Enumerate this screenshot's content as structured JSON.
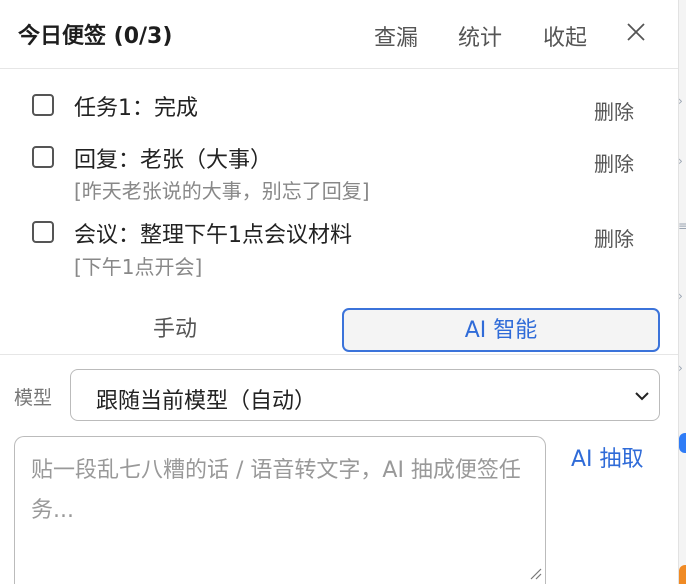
{
  "header": {
    "title": "今日便签 (0/3)",
    "actions": [
      "查漏",
      "统计",
      "收起"
    ],
    "close_icon": "close-icon"
  },
  "tasks": [
    {
      "title": "任务1：完成",
      "note": "",
      "delete_label": "删除",
      "checked": false
    },
    {
      "title": "回复：老张（大事）",
      "note": "[昨天老张说的大事，别忘了回复]",
      "delete_label": "删除",
      "checked": false
    },
    {
      "title": "会议：整理下午1点会议材料",
      "note": "[下午1点开会]",
      "delete_label": "删除",
      "checked": false
    }
  ],
  "mode_tabs": {
    "manual": "手动",
    "ai": "AI 智能",
    "active": "ai"
  },
  "model": {
    "label": "模型",
    "value": "跟随当前模型（自动）"
  },
  "input": {
    "placeholder": "贴一段乱七八糟的话 / 语音转文字，AI 抽成便签任务...",
    "value": ""
  },
  "ai_extract_label": "AI 抽取",
  "colors": {
    "accent": "#2f6bd8",
    "text": "#222222",
    "muted": "#888888",
    "border": "#bbbbbb"
  }
}
